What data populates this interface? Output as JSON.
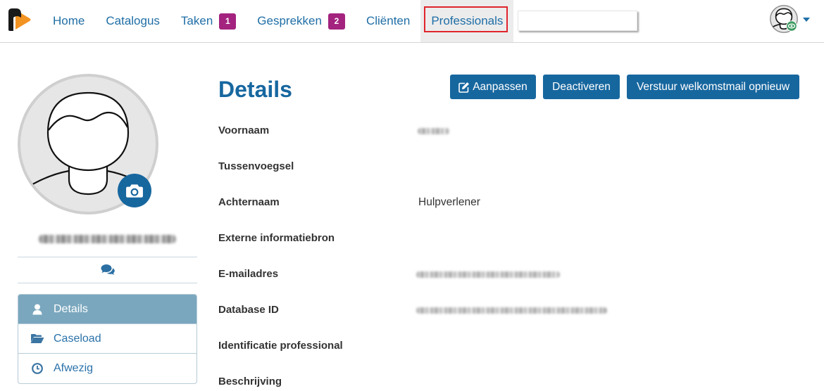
{
  "app": {
    "logo_icon": "logo-icon"
  },
  "nav": {
    "items": [
      {
        "label": "Home"
      },
      {
        "label": "Catalogus"
      },
      {
        "label": "Taken",
        "badge": "1"
      },
      {
        "label": "Gesprekken",
        "badge": "2"
      },
      {
        "label": "Cliënten"
      },
      {
        "label": "Professionals",
        "active": true
      }
    ],
    "user_menu": {
      "avatar_icon": "user-avatar-icon",
      "status_icon": "eye-icon",
      "caret_icon": "caret-down-icon"
    }
  },
  "profile": {
    "avatar_icon": "person-silhouette-icon",
    "camera_icon": "camera-icon",
    "name_redacted": true,
    "chat_icon": "comments-icon"
  },
  "sidebar": {
    "items": [
      {
        "label": "Details",
        "icon": "user-icon",
        "active": true
      },
      {
        "label": "Caseload",
        "icon": "folder-open-icon",
        "active": false
      },
      {
        "label": "Afwezig",
        "icon": "clock-icon",
        "active": false
      }
    ]
  },
  "main": {
    "title": "Details",
    "buttons": {
      "edit": {
        "label": "Aanpassen",
        "icon": "edit-icon"
      },
      "deactivate": {
        "label": "Deactiveren"
      },
      "resend_welcome": {
        "label": "Verstuur welkomstmail opnieuw"
      }
    },
    "fields": [
      {
        "label": "Voornaam",
        "redacted": true
      },
      {
        "label": "Tussenvoegsel"
      },
      {
        "label": "Achternaam",
        "value": "Hulpverlener"
      },
      {
        "label": "Externe informatiebron"
      },
      {
        "label": "E-mailadres",
        "redacted": true
      },
      {
        "label": "Database ID",
        "redacted": true
      },
      {
        "label": "Identificatie professional"
      },
      {
        "label": "Beschrijving"
      }
    ]
  },
  "colors": {
    "primary": "#17679f",
    "nav_link": "#1f6ea6",
    "badge": "#a3237f",
    "sidebar_active": "#7aa7be",
    "highlight_outline": "#e0242c",
    "status": "#3e9a60"
  }
}
